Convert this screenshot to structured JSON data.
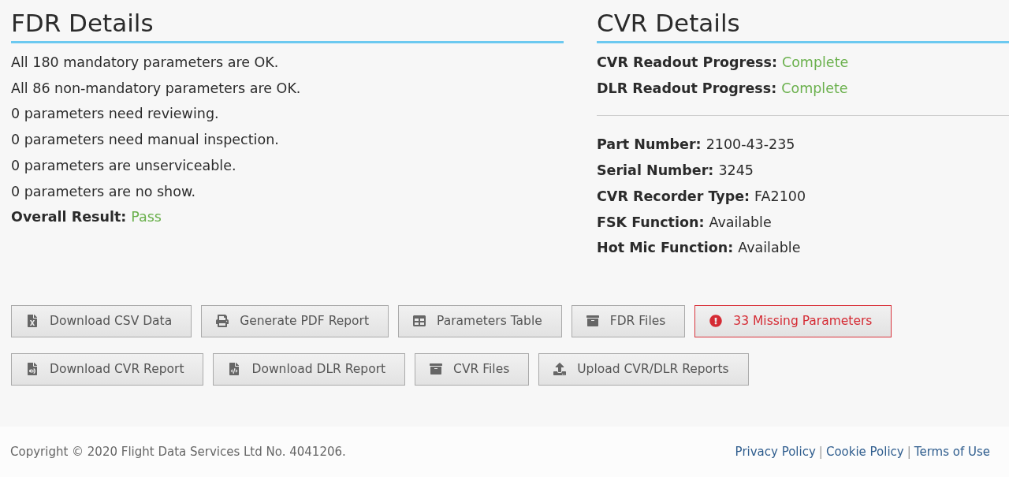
{
  "fdr": {
    "title": "FDR Details",
    "lines": [
      "All 180 mandatory parameters are OK.",
      "All 86 non-mandatory parameters are OK.",
      "0 parameters need reviewing.",
      "0 parameters need manual inspection.",
      "0 parameters are unserviceable.",
      "0 parameters are no show."
    ],
    "result": {
      "label": "Overall Result:",
      "value": "Pass",
      "color": "#6ab04c"
    }
  },
  "cvr": {
    "title": "CVR Details",
    "progress": [
      {
        "label": "CVR Readout Progress:",
        "value": "Complete",
        "color": "#6ab04c"
      },
      {
        "label": "DLR Readout Progress:",
        "value": "Complete",
        "color": "#6ab04c"
      }
    ],
    "details": [
      {
        "label": "Part Number:",
        "value": "2100-43-235"
      },
      {
        "label": "Serial Number:",
        "value": "3245"
      },
      {
        "label": "CVR Recorder Type:",
        "value": "FA2100"
      },
      {
        "label": "FSK Function:",
        "value": "Available"
      },
      {
        "label": "Hot Mic Function:",
        "value": "Available"
      }
    ]
  },
  "button_rows": [
    [
      {
        "label": "Download CSV Data",
        "kind": "default"
      },
      {
        "label": "Generate PDF Report",
        "kind": "default"
      },
      {
        "label": "Parameters Table",
        "kind": "default"
      },
      {
        "label": "FDR Files",
        "kind": "default"
      },
      {
        "label": "33 Missing Parameters",
        "kind": "alert"
      }
    ],
    [
      {
        "label": "Download CVR Report",
        "kind": "default"
      },
      {
        "label": "Download DLR Report",
        "kind": "default"
      },
      {
        "label": "CVR Files",
        "kind": "default"
      },
      {
        "label": "Upload CVR/DLR Reports",
        "kind": "default"
      }
    ]
  ],
  "footer": {
    "copyright": "Copyright © 2020 Flight Data Services Ltd No. 4041206.",
    "links": [
      "Privacy Policy",
      "Cookie Policy",
      "Terms of Use"
    ],
    "separator": "|"
  }
}
